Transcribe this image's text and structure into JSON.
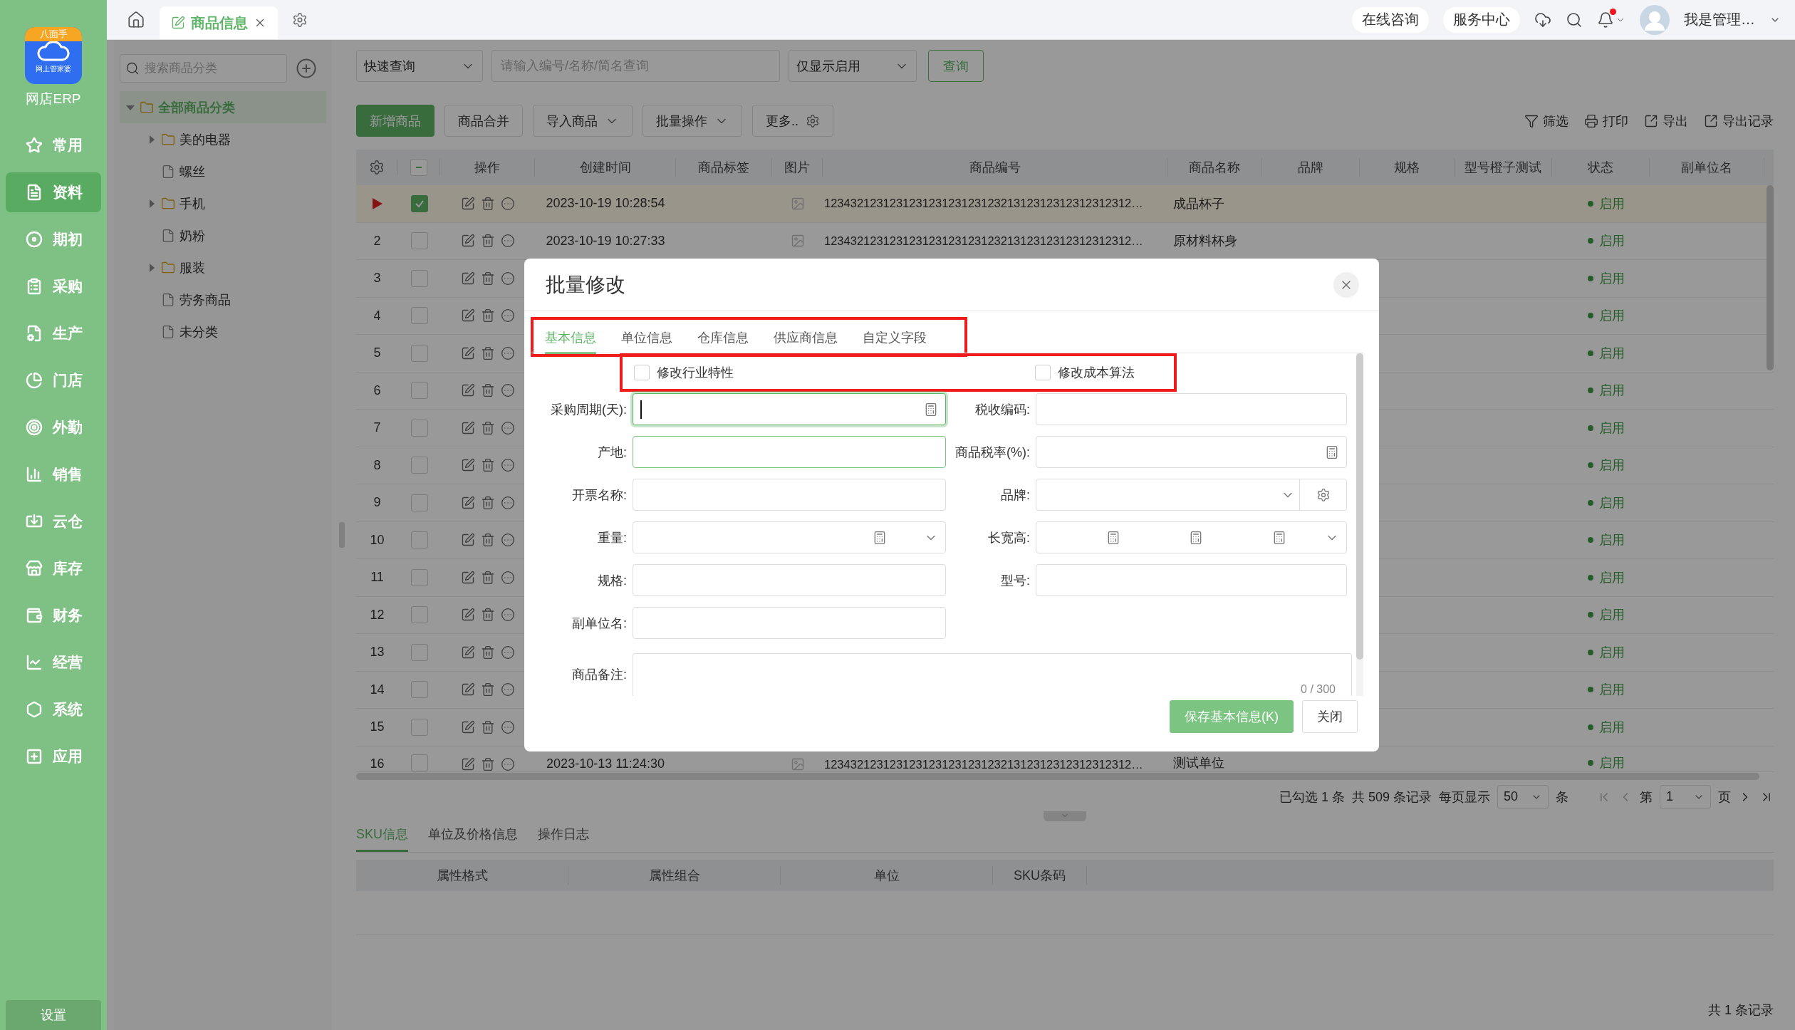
{
  "app": {
    "logo_badge": "八面手",
    "logo_text": "网上管家婆",
    "name": "网店ERP"
  },
  "nav": [
    {
      "label": "常用",
      "selected": false
    },
    {
      "label": "资料",
      "selected": true
    },
    {
      "label": "期初",
      "selected": false
    },
    {
      "label": "采购",
      "selected": false
    },
    {
      "label": "生产",
      "selected": false
    },
    {
      "label": "门店",
      "selected": false
    },
    {
      "label": "外勤",
      "selected": false
    },
    {
      "label": "销售",
      "selected": false
    },
    {
      "label": "云仓",
      "selected": false
    },
    {
      "label": "库存",
      "selected": false
    },
    {
      "label": "财务",
      "selected": false
    },
    {
      "label": "经营",
      "selected": false
    },
    {
      "label": "系统",
      "selected": false
    },
    {
      "label": "应用",
      "selected": false
    }
  ],
  "settings_button": "设置",
  "tabs": [
    {
      "label": "商品信息",
      "selected": true
    }
  ],
  "header_links": [
    "在线咨询",
    "服务中心"
  ],
  "notification": {
    "unread": true
  },
  "user": {
    "name": "我是管理…"
  },
  "category_tree": {
    "search_placeholder": "搜索商品分类",
    "items": [
      {
        "label": "全部商品分类",
        "kind": "folder",
        "expanded": true,
        "selected": true,
        "children": [
          {
            "label": "美的电器",
            "kind": "folder",
            "expanded": false,
            "selected": false
          },
          {
            "label": "螺丝",
            "kind": "file",
            "selected": false
          },
          {
            "label": "手机",
            "kind": "folder",
            "expanded": false,
            "selected": false
          },
          {
            "label": "奶粉",
            "kind": "file",
            "selected": false
          },
          {
            "label": "服装",
            "kind": "folder",
            "expanded": false,
            "selected": false
          },
          {
            "label": "劳务商品",
            "kind": "file",
            "selected": false
          },
          {
            "label": "未分类",
            "kind": "file",
            "selected": false
          }
        ]
      }
    ]
  },
  "filters": {
    "mode": "快速查询",
    "search_placeholder": "请输入编号/名称/简名查询",
    "status": "仅显示启用",
    "query_button": "查询"
  },
  "toolbar": {
    "left": [
      {
        "label": "新增商品",
        "kind": "primary"
      },
      {
        "label": "商品合并",
        "kind": "plain"
      },
      {
        "label": "导入商品",
        "kind": "dropdown"
      },
      {
        "label": "批量操作",
        "kind": "dropdown"
      },
      {
        "label": "更多..",
        "kind": "gear"
      }
    ],
    "right": [
      {
        "label": "筛选",
        "kind": "filter"
      },
      {
        "label": "打印",
        "kind": "print"
      },
      {
        "label": "导出",
        "kind": "export"
      },
      {
        "label": "导出记录",
        "kind": "export"
      }
    ]
  },
  "table": {
    "header_checkbox": {
      "indeterminate": true
    },
    "columns": [
      "操作",
      "创建时间",
      "商品标签",
      "图片",
      "商品编号",
      "商品名称",
      "品牌",
      "规格",
      "型号橙子测试",
      "状态",
      "副单位名"
    ],
    "rows": [
      {
        "current": true,
        "checked": true,
        "created": "2023-10-19 10:28:54",
        "code": "12343212312312312312312312321312312312312312312…",
        "name": "成品杯子",
        "status": "启用"
      },
      {
        "number": "2",
        "current": false,
        "checked": false,
        "created": "2023-10-19 10:27:33",
        "code": "12343212312312312312312312321312312312312312312…",
        "name": "原材料杯身",
        "status": "启用"
      },
      {
        "number": "3",
        "current": false,
        "checked": false,
        "status": "启用"
      },
      {
        "number": "4",
        "current": false,
        "checked": false,
        "status": "启用"
      },
      {
        "number": "5",
        "current": false,
        "checked": false,
        "status": "启用"
      },
      {
        "number": "6",
        "current": false,
        "checked": false,
        "status": "启用"
      },
      {
        "number": "7",
        "current": false,
        "checked": false,
        "status": "启用"
      },
      {
        "number": "8",
        "current": false,
        "checked": false,
        "status": "启用"
      },
      {
        "number": "9",
        "current": false,
        "checked": false,
        "status": "启用"
      },
      {
        "number": "10",
        "current": false,
        "checked": false,
        "status": "启用"
      },
      {
        "number": "11",
        "current": false,
        "checked": false,
        "status": "启用"
      },
      {
        "number": "12",
        "current": false,
        "checked": false,
        "status": "启用"
      },
      {
        "number": "13",
        "current": false,
        "checked": false,
        "status": "启用"
      },
      {
        "number": "14",
        "current": false,
        "checked": false,
        "status": "启用"
      },
      {
        "number": "15",
        "current": false,
        "checked": false,
        "status": "启用"
      },
      {
        "number": "16",
        "current": false,
        "checked": false,
        "created": "2023-10-13 11:24:30",
        "code": "12343212312312312312312312321312312312312312312…",
        "name": "测试单位",
        "status": "启用"
      }
    ]
  },
  "pager": {
    "selected_count": "已勾选 1 条",
    "total": "共 509 条记录",
    "page_size_label": "每页显示",
    "page_size": "50",
    "page_size_unit": "条",
    "page_label": "第",
    "page": "1",
    "page_unit": "页"
  },
  "detail_tabs": [
    {
      "label": "SKU信息",
      "selected": true
    },
    {
      "label": "单位及价格信息",
      "selected": false
    },
    {
      "label": "操作日志",
      "selected": false
    }
  ],
  "sku_table": {
    "columns": [
      "属性格式",
      "属性组合",
      "单位",
      "SKU条码"
    ],
    "footer": "共 1 条记录"
  },
  "dialog": {
    "title": "批量修改",
    "tabs_highlighted": true,
    "tabs": [
      {
        "label": "基本信息",
        "selected": true
      },
      {
        "label": "单位信息",
        "selected": false
      },
      {
        "label": "仓库信息",
        "selected": false
      },
      {
        "label": "供应商信息",
        "selected": false
      },
      {
        "label": "自定义字段",
        "selected": false
      }
    ],
    "options_highlighted": true,
    "options": [
      {
        "label": "修改行业特性",
        "checked": false
      },
      {
        "label": "修改成本算法",
        "checked": false
      }
    ],
    "fields": [
      {
        "label": "采购周期(天):",
        "kind": "number",
        "highlighted": true,
        "focused": true
      },
      {
        "label": "税收编码:",
        "kind": "text",
        "highlighted": false,
        "focused": false
      },
      {
        "label": "产地:",
        "kind": "text",
        "highlighted": true,
        "focused": false
      },
      {
        "label": "商品税率(%):",
        "kind": "number",
        "highlighted": false,
        "focused": false
      },
      {
        "label": "开票名称:",
        "kind": "text",
        "highlighted": false,
        "focused": false
      },
      {
        "label": "品牌:",
        "kind": "select_gear",
        "highlighted": false,
        "focused": false
      },
      {
        "label": "重量:",
        "kind": "number_select",
        "highlighted": false,
        "focused": false
      },
      {
        "label": "长宽高:",
        "kind": "dimensions",
        "highlighted": false,
        "focused": false
      },
      {
        "label": "规格:",
        "kind": "text",
        "highlighted": false,
        "focused": false
      },
      {
        "label": "型号:",
        "kind": "text",
        "highlighted": false,
        "focused": false
      },
      {
        "label": "副单位名:",
        "kind": "text",
        "highlighted": false,
        "focused": false
      }
    ],
    "remark": {
      "label": "商品备注:",
      "counter": "0 / 300"
    },
    "buttons": [
      {
        "label": "保存基本信息(K)",
        "kind": "primary"
      },
      {
        "label": "关闭",
        "kind": "plain"
      }
    ]
  }
}
